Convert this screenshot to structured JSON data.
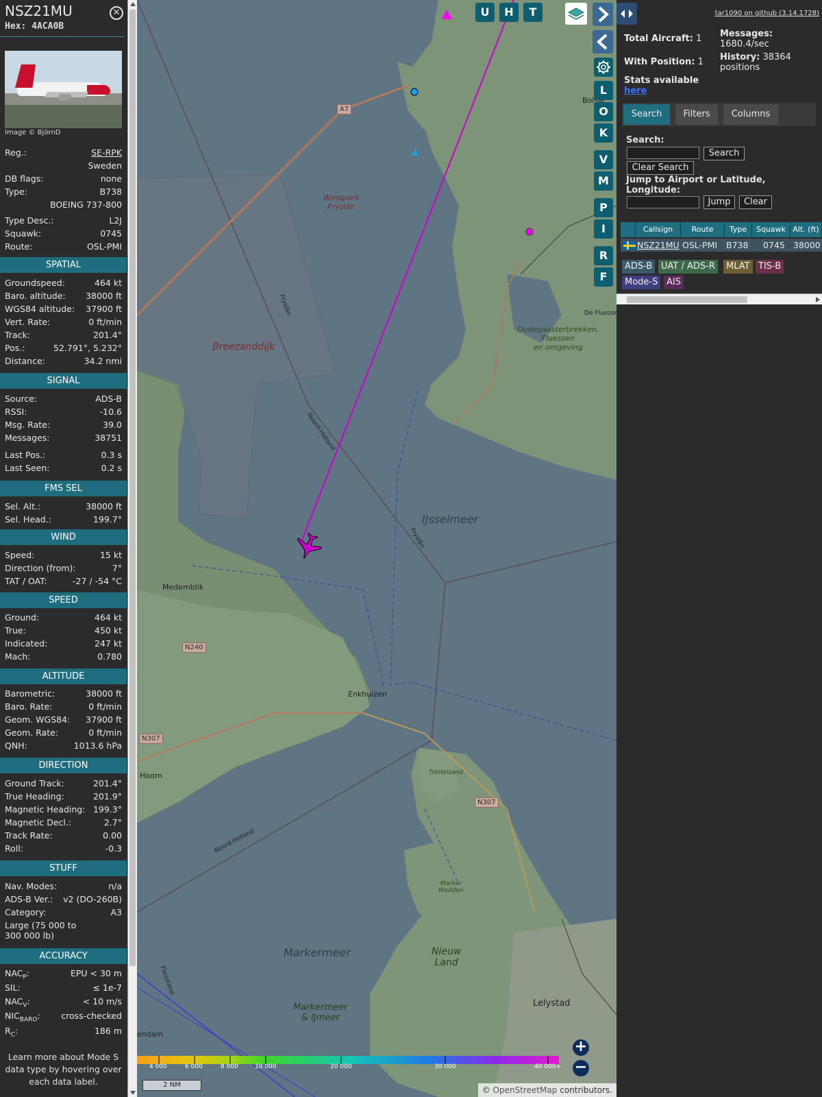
{
  "aircraft": {
    "callsign": "NSZ21MU",
    "hex_label": "Hex:",
    "hex": "4ACA0B",
    "photo_credit": "Image © BjörnD"
  },
  "info_rows": [
    {
      "label": "Reg.:",
      "value": "SE-RPK"
    },
    {
      "label": "",
      "value": "Sweden"
    },
    {
      "label": "DB flags:",
      "value": "none"
    },
    {
      "label": "Type:",
      "value": "B738"
    },
    {
      "label": "",
      "value": "BOEING 737-800"
    },
    {
      "label": "Type Desc.:",
      "value": "L2J"
    },
    {
      "label": "Squawk:",
      "value": "0745"
    },
    {
      "label": "Route:",
      "value": "OSL-PMI"
    }
  ],
  "sections": {
    "spatial": {
      "title": "SPATIAL",
      "rows": [
        {
          "label": "Groundspeed:",
          "value": "464 kt"
        },
        {
          "label": "Baro. altitude:",
          "value": "38000 ft"
        },
        {
          "label": "WGS84 altitude:",
          "value": "37900 ft"
        },
        {
          "label": "Vert. Rate:",
          "value": "0 ft/min"
        },
        {
          "label": "Track:",
          "value": "201.4°"
        },
        {
          "label": "Pos.:",
          "value": "52.791°, 5.232°"
        },
        {
          "label": "Distance:",
          "value": "34.2 nmi"
        }
      ]
    },
    "signal": {
      "title": "SIGNAL",
      "rows": [
        {
          "label": "Source:",
          "value": "ADS-B"
        },
        {
          "label": "RSSI:",
          "value": "-10.6"
        },
        {
          "label": "Msg. Rate:",
          "value": "39.0"
        },
        {
          "label": "Messages:",
          "value": "38751"
        },
        {
          "label": "Last Pos.:",
          "value": "0.3 s"
        },
        {
          "label": "Last Seen:",
          "value": "0.2 s"
        }
      ]
    },
    "fms": {
      "title": "FMS SEL",
      "rows": [
        {
          "label": "Sel. Alt.:",
          "value": "38000 ft"
        },
        {
          "label": "Sel. Head.:",
          "value": "199.7°"
        }
      ]
    },
    "wind": {
      "title": "WIND",
      "rows": [
        {
          "label": "Speed:",
          "value": "15 kt"
        },
        {
          "label": "Direction (from):",
          "value": "7°"
        },
        {
          "label": "TAT / OAT:",
          "value": "-27 / -54 °C"
        }
      ]
    },
    "speed": {
      "title": "SPEED",
      "rows": [
        {
          "label": "Ground:",
          "value": "464 kt"
        },
        {
          "label": "True:",
          "value": "450 kt"
        },
        {
          "label": "Indicated:",
          "value": "247 kt"
        },
        {
          "label": "Mach:",
          "value": "0.780"
        }
      ]
    },
    "altitude": {
      "title": "ALTITUDE",
      "rows": [
        {
          "label": "Barometric:",
          "value": "38000 ft"
        },
        {
          "label": "Baro. Rate:",
          "value": "0 ft/min"
        },
        {
          "label": "Geom. WGS84:",
          "value": "37900 ft"
        },
        {
          "label": "Geom. Rate:",
          "value": "0 ft/min"
        },
        {
          "label": "QNH:",
          "value": "1013.6 hPa"
        }
      ]
    },
    "direction": {
      "title": "DIRECTION",
      "rows": [
        {
          "label": "Ground Track:",
          "value": "201.4°"
        },
        {
          "label": "True Heading:",
          "value": "201.9°"
        },
        {
          "label": "Magnetic Heading:",
          "value": "199.3°"
        },
        {
          "label": "Magnetic Decl.:",
          "value": "2.7°"
        },
        {
          "label": "Track Rate:",
          "value": "0.00"
        },
        {
          "label": "Roll:",
          "value": "-0.3"
        }
      ]
    },
    "stuff": {
      "title": "STUFF",
      "rows": [
        {
          "label": "Nav. Modes:",
          "value": "n/a"
        },
        {
          "label": "ADS-B Ver.:",
          "value": "v2 (DO-260B)"
        },
        {
          "label": "Category:",
          "value": "A3"
        }
      ],
      "category_desc_1": "Large (75 000 to",
      "category_desc_2": "300 000 lb)"
    },
    "accuracy": {
      "title": "ACCURACY",
      "rows": [
        {
          "label": "NACP:",
          "value": "EPU < 30 m"
        },
        {
          "label": "SIL:",
          "value": "≤ 1e-7"
        },
        {
          "label": "NACV:",
          "value": "< 10 m/s"
        },
        {
          "label": "NICBARO:",
          "value": "cross-checked"
        },
        {
          "label": "RC:",
          "value": "186 m"
        }
      ]
    }
  },
  "learn_more": [
    "Learn more about Mode S",
    "data type by hovering over",
    "each data label."
  ],
  "map": {
    "labels": {
      "windpark": [
        "Windpark",
        "Fryslân"
      ],
      "breezanddijk": "Breezanddijk",
      "ijsselmeer": "IJsselmeer",
      "markermeer": "Markermeer",
      "markermeer_ijmeer": [
        "Markermeer",
        "& IJmeer"
      ],
      "nieuw_land": [
        "Nieuw",
        "Land"
      ],
      "marker_wadden": [
        "Marker",
        "Wadden"
      ],
      "trintelzand": "Trintelzand",
      "oudega": [
        "Oudegaasterbrekken,",
        "Fluessen",
        "en omgeving"
      ],
      "medemblik": "Medemblik",
      "enkhuizen": "Enkhuizen",
      "hoorn": "Hoorn",
      "lelystad": "Lelystad",
      "bolsward": "Bolsw",
      "de_fluezen": "De Fluezen",
      "almere": "endam",
      "fryslan1": "Fryslân",
      "fryslan2": "Fryslân",
      "noord_holland1": "Noord-Holland",
      "noord_holland2": "Noord-Holland",
      "flevoland": "Flevoland"
    },
    "road_shields": [
      "A7",
      "N240",
      "N307",
      "N307"
    ],
    "buttons": {
      "u": "U",
      "h": "H",
      "t": "T",
      "l": "L",
      "o": "O",
      "k": "K",
      "v": "V",
      "m": "M",
      "p": "P",
      "i": "I",
      "r": "R",
      "f": "F"
    },
    "alt_ticks": [
      "4 000",
      "6 000",
      "8 000",
      "10 000",
      "20 000",
      "30 000",
      "40 000+"
    ],
    "scale_label": "2 NM",
    "attribution_prefix": "© ",
    "attribution_link": "OpenStreetMap",
    "attribution_suffix": " contributors.",
    "icons": {
      "layers": "layers-icon",
      "gear": "gear-icon",
      "plane": "plane-icon"
    },
    "colors": {
      "track": "#cc00cc",
      "water": "#5f7583",
      "land": "#7e9478"
    }
  },
  "right": {
    "github_link": "tar1090 on github (3.14.1728)",
    "total_aircraft_label": "Total Aircraft:",
    "total_aircraft": "1",
    "with_position_label": "With Position:",
    "with_position": "1",
    "messages_label": "Messages:",
    "messages_rate": "1680.4/sec",
    "history_label": "History:",
    "history_value": "38364",
    "history_unit": "positions",
    "stats_label": "Stats available",
    "stats_link": "here",
    "tabs": [
      "Search",
      "Filters",
      "Columns"
    ],
    "search_label": "Search:",
    "search_button": "Search",
    "clear_search_button": "Clear Search",
    "jump_label_1": "Jump to Airport or Latitude,",
    "jump_label_2": "Longitude:",
    "jump_button": "Jump",
    "clear_button": "Clear",
    "table_headers": [
      "Callsign",
      "Route",
      "Type",
      "Squawk",
      "Alt. (ft)"
    ],
    "table_row": {
      "callsign": "NSZ21MU",
      "route": "OSL-PMI",
      "type": "B738",
      "squawk": "0745",
      "alt": "38000"
    },
    "sources": [
      "ADS-B",
      "UAT / ADS-R",
      "MLAT",
      "TIS-B",
      "Mode-S",
      "AIS"
    ]
  }
}
